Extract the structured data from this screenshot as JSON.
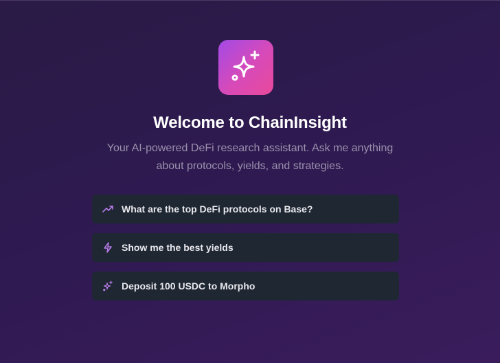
{
  "welcome": {
    "title": "Welcome to ChainInsight",
    "subtitle": "Your AI-powered DeFi research assistant. Ask me anything about protocols, yields, and strategies."
  },
  "logo_icon": "sparkles-icon",
  "colors": {
    "accent_icon": "#b77ae8",
    "logo_gradient_start": "#a34ae6",
    "logo_gradient_end": "#e84a9a",
    "card_bg": "#1f2733"
  },
  "suggestions": [
    {
      "label": "What are the top DeFi protocols on Base?",
      "icon": "trending-up-icon"
    },
    {
      "label": "Show me the best yields",
      "icon": "lightning-icon"
    },
    {
      "label": "Deposit 100 USDC to Morpho",
      "icon": "sparkles-icon"
    }
  ]
}
